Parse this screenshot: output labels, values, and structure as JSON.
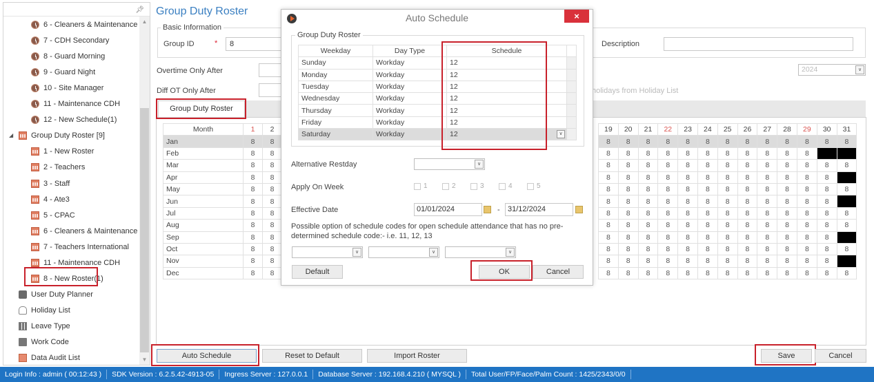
{
  "sidebar": {
    "pin_icon": "pin-icon",
    "schedule_items": [
      "6 - Cleaners & Maintenance",
      "7 - CDH Secondary",
      "8 - Guard Morning",
      "9 - Guard Night",
      "10 - Site Manager",
      "11 - Maintenance CDH",
      "12 - New Schedule(1)"
    ],
    "group_roster_header": "Group Duty Roster [9]",
    "roster_items": [
      "1 - New Roster",
      "2 - Teachers",
      "3 - Staff",
      "4 - Ate3",
      "5 - CPAC",
      "6 - Cleaners & Maintenance",
      "7 - Teachers International",
      "11 - Maintenance CDH",
      "8 - New Roster(1)"
    ],
    "bottom_items": [
      {
        "label": "User Duty Planner",
        "icon": "briefcase-icon"
      },
      {
        "label": "Holiday List",
        "icon": "flip-flops-icon"
      },
      {
        "label": "Leave Type",
        "icon": "grid-icon"
      },
      {
        "label": "Work Code",
        "icon": "chat-icon"
      },
      {
        "label": "Data Audit List",
        "icon": "audit-icon"
      }
    ]
  },
  "main": {
    "title": "Group Duty Roster",
    "basic_info_legend": "Basic Information",
    "group_id_label": "Group ID",
    "required_marker": "*",
    "group_id_value": "8",
    "description_label": "Description",
    "description_value": "",
    "overtime_label": "Overtime Only After",
    "diff_ot_label": "Diff OT Only After",
    "year_value": "2024",
    "holiday_hint": "holidays from Holiday List",
    "tab_label": "Group Duty Roster"
  },
  "roster": {
    "month_header": "Month",
    "left_days": [
      "1",
      "2"
    ],
    "right_days": [
      "19",
      "20",
      "21",
      "22",
      "23",
      "24",
      "25",
      "26",
      "27",
      "28",
      "29",
      "30",
      "31"
    ],
    "red_days": [
      "1",
      "22",
      "29"
    ],
    "months": [
      "Jan",
      "Feb",
      "Mar",
      "Apr",
      "May",
      "Jun",
      "Jul",
      "Aug",
      "Sep",
      "Oct",
      "Nov",
      "Dec"
    ],
    "cell_value": "8",
    "selected_month": "Jan",
    "blocked_cells": {
      "Feb": [
        "30",
        "31"
      ],
      "Apr": [
        "31"
      ],
      "Jun": [
        "31"
      ],
      "Sep": [
        "31"
      ],
      "Nov": [
        "31"
      ]
    }
  },
  "buttons": {
    "auto_schedule": "Auto Schedule",
    "reset_default": "Reset to Default",
    "import_roster": "Import Roster",
    "save": "Save",
    "cancel": "Cancel"
  },
  "status_bar": [
    "Login Info : admin ( 00:12:43 )",
    "SDK Version : 6.2.5.42-4913-05",
    "Ingress Server : 127.0.0.1",
    "Database Server : 192.168.4.210 ( MYSQL )",
    "Total User/FP/Face/Palm Count : 1425/2343/0/0"
  ],
  "dialog": {
    "title": "Auto Schedule",
    "close_label": "×",
    "group_legend": "Group Duty Roster",
    "columns": [
      "Weekday",
      "Day Type",
      "Schedule"
    ],
    "rows": [
      {
        "weekday": "Sunday",
        "day_type": "Workday",
        "schedule": "12"
      },
      {
        "weekday": "Monday",
        "day_type": "Workday",
        "schedule": "12"
      },
      {
        "weekday": "Tuesday",
        "day_type": "Workday",
        "schedule": "12"
      },
      {
        "weekday": "Wednesday",
        "day_type": "Workday",
        "schedule": "12"
      },
      {
        "weekday": "Thursday",
        "day_type": "Workday",
        "schedule": "12"
      },
      {
        "weekday": "Friday",
        "day_type": "Workday",
        "schedule": "12"
      },
      {
        "weekday": "Saturday",
        "day_type": "Workday",
        "schedule": "12"
      }
    ],
    "alt_restday_label": "Alternative Restday",
    "alt_restday_value": "",
    "apply_on_week_label": "Apply On Week",
    "weeks": [
      "1",
      "2",
      "3",
      "4",
      "5"
    ],
    "effective_date_label": "Effective Date",
    "date_from": "01/01/2024",
    "date_sep": "-",
    "date_to": "31/12/2024",
    "hint": "Possible option of schedule codes for open schedule attendance that has no pre-determined schedule code:- i.e. 11, 12, 13",
    "option_values": [
      "",
      "",
      ""
    ],
    "default_label": "Default",
    "ok_label": "OK",
    "cancel_label": "Cancel"
  },
  "colors": {
    "accent": "#3a7fc1",
    "status_bar": "#1f74c4",
    "highlight": "#c8202a",
    "close_button": "#d9313b",
    "holiday_day": "#d9534f"
  }
}
